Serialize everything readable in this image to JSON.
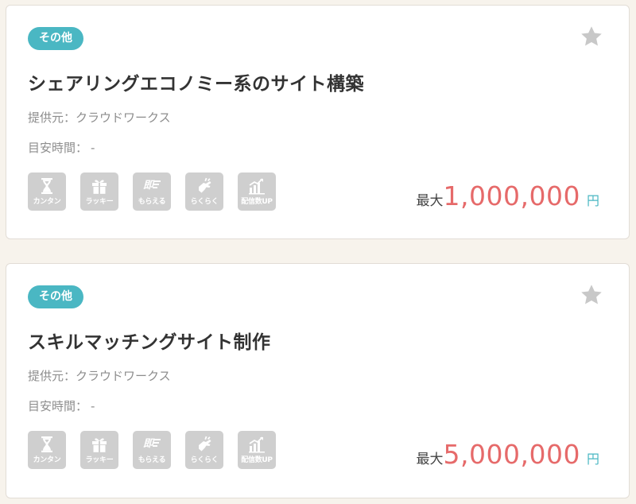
{
  "colors": {
    "badge": "#4ab7c3",
    "amount": "#e66a6a",
    "unit": "#4ab7c3",
    "tag": "#cfcfcf",
    "star": "#c8c8c8"
  },
  "jobs": [
    {
      "category": "その他",
      "title": "シェアリングエコノミー系のサイト構築",
      "provider_label": "提供元：",
      "provider": "クラウドワークス",
      "time_label": "目安時間：",
      "time": "-",
      "tags": [
        {
          "label": "カンタン",
          "icon": "hourglass-icon"
        },
        {
          "label": "ラッキー",
          "icon": "gift-icon"
        },
        {
          "label": "もらえる",
          "icon": "instant-icon"
        },
        {
          "label": "らくらく",
          "icon": "hand-icon"
        },
        {
          "label": "配信数UP",
          "icon": "chart-up-icon"
        }
      ],
      "reward_prefix": "最大",
      "reward_amount": "1,000,000",
      "reward_unit": "円"
    },
    {
      "category": "その他",
      "title": "スキルマッチングサイト制作",
      "provider_label": "提供元：",
      "provider": "クラウドワークス",
      "time_label": "目安時間：",
      "time": "-",
      "tags": [
        {
          "label": "カンタン",
          "icon": "hourglass-icon"
        },
        {
          "label": "ラッキー",
          "icon": "gift-icon"
        },
        {
          "label": "もらえる",
          "icon": "instant-icon"
        },
        {
          "label": "らくらく",
          "icon": "hand-icon"
        },
        {
          "label": "配信数UP",
          "icon": "chart-up-icon"
        }
      ],
      "reward_prefix": "最大",
      "reward_amount": "5,000,000",
      "reward_unit": "円"
    }
  ]
}
